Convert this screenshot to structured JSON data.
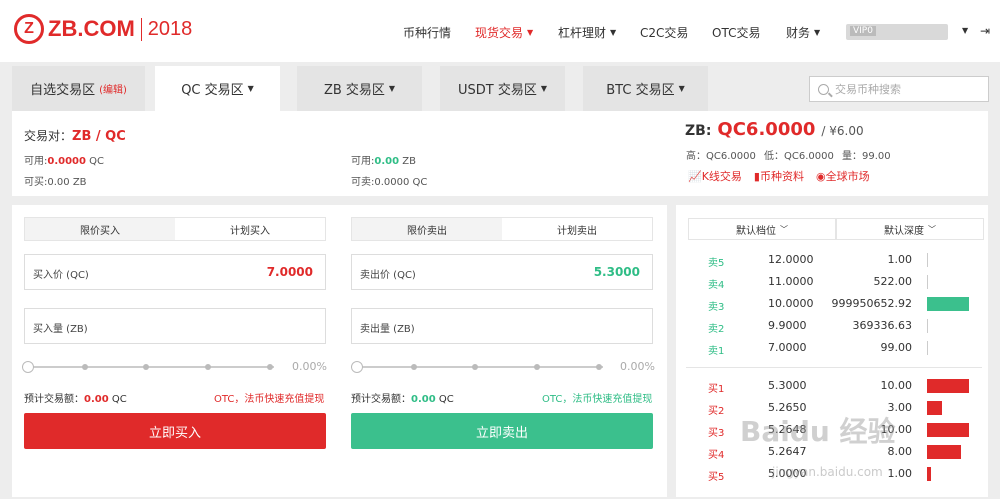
{
  "header": {
    "brand": "ZB.COM",
    "year": "2018",
    "nav": [
      {
        "label": "币种行情"
      },
      {
        "label": "现货交易"
      },
      {
        "label": "杠杆理财"
      },
      {
        "label": "C2C交易"
      },
      {
        "label": "OTC交易"
      },
      {
        "label": "财务"
      }
    ],
    "vip": "VIP0",
    "accent": "#e02a2a"
  },
  "tabs": [
    {
      "label": "自选交易区",
      "edit": "(编辑)"
    },
    {
      "label": "QC 交易区"
    },
    {
      "label": "ZB 交易区"
    },
    {
      "label": "USDT 交易区"
    },
    {
      "label": "BTC 交易区"
    }
  ],
  "search": {
    "placeholder": "交易币种搜索"
  },
  "info": {
    "pair_label": "交易对：",
    "pair": "ZB / QC",
    "avail_qc_label": "可用:",
    "avail_qc": "0.0000",
    "avail_qc_unit": "QC",
    "can_buy_label": "可买:",
    "can_buy": "0.00 ZB",
    "avail_zb_label": "可用:",
    "avail_zb": "0.00",
    "avail_zb_unit": "ZB",
    "can_sell_label": "可卖:",
    "can_sell": "0.0000 QC",
    "coin": "ZB:",
    "price": "QC6.0000",
    "cny": "/ ¥6.00",
    "high": "高：QC6.0000",
    "low": "低：QC6.0000",
    "vol": "量：99.00",
    "links": [
      "K线交易",
      "币种资料",
      "全球市场"
    ]
  },
  "buy": {
    "tabs": [
      "限价买入",
      "计划买入"
    ],
    "price_label": "买入价 (QC)",
    "price": "7.0000",
    "amount_label": "买入量 (ZB)",
    "pct": "0.00%",
    "est_label": "预计交易额：",
    "est": "0.00",
    "est_unit": "QC",
    "otc": "OTC，法币快速充值提现",
    "button": "立即买入",
    "color": "#e02a2a"
  },
  "sell": {
    "tabs": [
      "限价卖出",
      "计划卖出"
    ],
    "price_label": "卖出价 (QC)",
    "price": "5.3000",
    "amount_label": "卖出量 (ZB)",
    "pct": "0.00%",
    "est_label": "预计交易额：",
    "est": "0.00",
    "est_unit": "QC",
    "otc": "OTC，法币快速充值提现",
    "button": "立即卖出",
    "color": "#3bc08d"
  },
  "book": {
    "headers": [
      "默认档位",
      "默认深度"
    ],
    "asks": [
      {
        "side": "卖5",
        "price": "12.0000",
        "qty": "1.00",
        "depth": 0
      },
      {
        "side": "卖4",
        "price": "11.0000",
        "qty": "522.00",
        "depth": 0
      },
      {
        "side": "卖3",
        "price": "10.0000",
        "qty": "999950652.92",
        "depth": 1
      },
      {
        "side": "卖2",
        "price": "9.9000",
        "qty": "369336.63",
        "depth": 0
      },
      {
        "side": "卖1",
        "price": "7.0000",
        "qty": "99.00",
        "depth": 0
      }
    ],
    "bids": [
      {
        "side": "买1",
        "price": "5.3000",
        "qty": "10.00",
        "depth": 1
      },
      {
        "side": "买2",
        "price": "5.2650",
        "qty": "3.00",
        "depth": 0.35
      },
      {
        "side": "买3",
        "price": "5.2648",
        "qty": "10.00",
        "depth": 1
      },
      {
        "side": "买4",
        "price": "5.2647",
        "qty": "8.00",
        "depth": 0.8
      },
      {
        "side": "买5",
        "price": "5.0000",
        "qty": "1.00",
        "depth": 0.1
      }
    ]
  },
  "watermark": {
    "text": "Baidu 经验",
    "url": "jingyan.baidu.com"
  }
}
